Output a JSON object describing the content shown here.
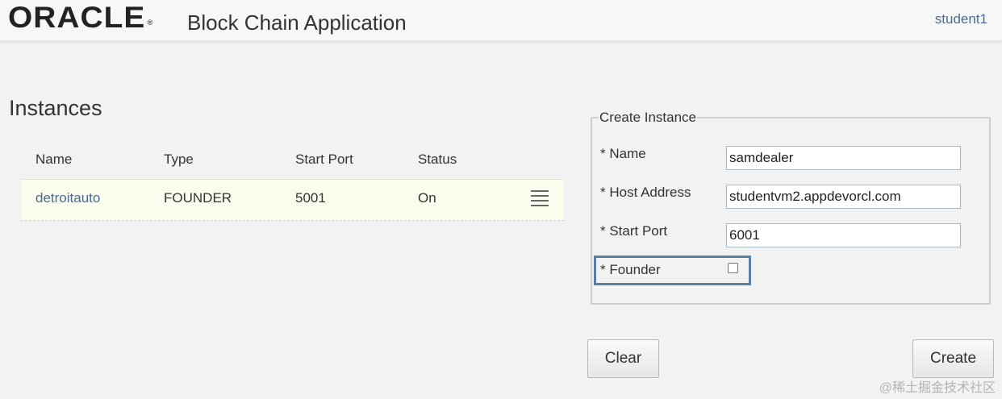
{
  "header": {
    "logo": "ORACLE",
    "logo_mark": "®",
    "app_title": "Block Chain Application",
    "user": "student1"
  },
  "instances": {
    "title": "Instances",
    "columns": [
      "Name",
      "Type",
      "Start Port",
      "Status"
    ],
    "rows": [
      {
        "name": "detroitauto",
        "type": "FOUNDER",
        "start_port": "5001",
        "status": "On"
      }
    ]
  },
  "create_instance": {
    "legend": "Create Instance",
    "name_label": "* Name",
    "name_value": "samdealer",
    "host_label": "* Host Address",
    "host_value": "studentvm2.appdevorcl.com",
    "port_label": "* Start Port",
    "port_value": "6001",
    "founder_label": "* Founder",
    "founder_checked": false
  },
  "buttons": {
    "clear": "Clear",
    "create": "Create"
  },
  "watermark": "@稀土掘金技术社区"
}
